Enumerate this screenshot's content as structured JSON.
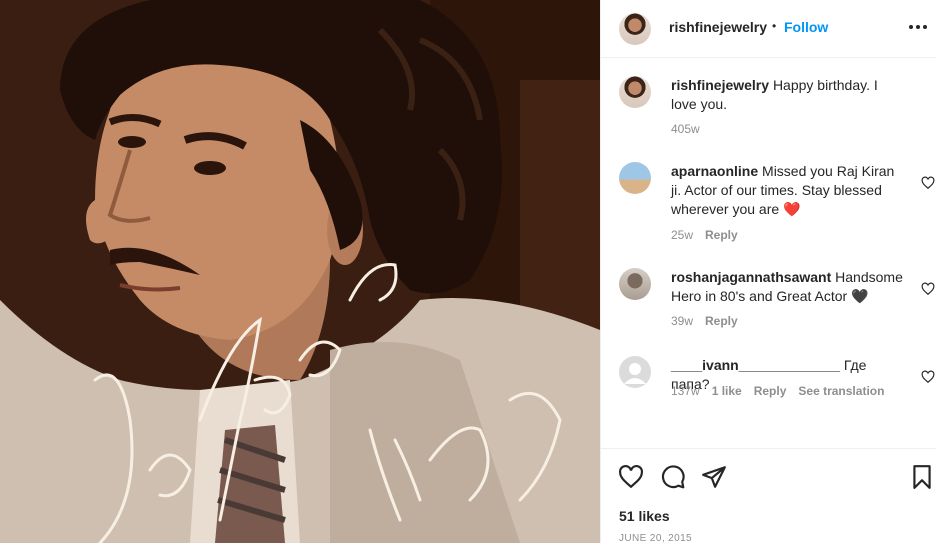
{
  "post": {
    "image_alt": "Vintage portrait photo with handwritten signature",
    "signature_text": "Love Always, Kiran"
  },
  "header": {
    "username": "rishfinejewelry",
    "separator": "•",
    "follow_label": "Follow"
  },
  "comments": [
    {
      "username": "rishfinejewelry",
      "text": "Happy birthday. I love you.",
      "time": "405w",
      "likes": "",
      "reply_label": "",
      "translation_label": ""
    },
    {
      "username": "aparnaonline",
      "text": "Missed you Raj Kiran ji. Actor of our times. Stay blessed wherever you are",
      "emoji": "❤️",
      "time": "25w",
      "likes": "",
      "reply_label": "Reply",
      "translation_label": ""
    },
    {
      "username": "roshanjagannathsawant",
      "text": "Handsome Hero in 80's and Great Actor",
      "emoji": "🖤",
      "time": "39w",
      "likes": "",
      "reply_label": "Reply",
      "translation_label": ""
    },
    {
      "username": "____ivann_____________",
      "text": "Где папа?",
      "time": "137w",
      "likes": "1 like",
      "reply_label": "Reply",
      "translation_label": "See translation"
    }
  ],
  "actions": {
    "likes_label": "51 likes",
    "date": "JUNE 20, 2015"
  },
  "colors": {
    "accent": "#0095f6",
    "text": "#262626",
    "muted": "#8e8e8e",
    "heart": "#e0245e"
  },
  "icons": [
    "more-icon",
    "heart-icon",
    "comment-icon",
    "share-icon",
    "bookmark-icon",
    "small-heart-icon",
    "default-avatar-icon"
  ]
}
